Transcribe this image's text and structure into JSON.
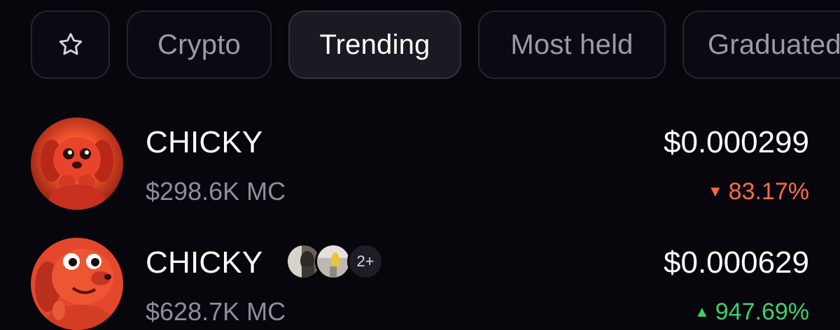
{
  "tabs": {
    "favorites_icon": "star-icon",
    "items": [
      {
        "label": "Crypto"
      },
      {
        "label": "Trending"
      },
      {
        "label": "Most held"
      },
      {
        "label": "Graduated"
      }
    ],
    "selected": "Trending"
  },
  "tokens": [
    {
      "name": "CHICKY",
      "market_cap": "$298.6K MC",
      "price": "$0.000299",
      "change": "83.17%",
      "direction": "down"
    },
    {
      "name": "CHICKY",
      "market_cap": "$628.7K MC",
      "price": "$0.000629",
      "change": "947.69%",
      "direction": "up",
      "holders_more": "2+"
    }
  ],
  "colors": {
    "background": "#07060d",
    "negative": "#ff6a3d",
    "positive": "#3ecf6b"
  }
}
